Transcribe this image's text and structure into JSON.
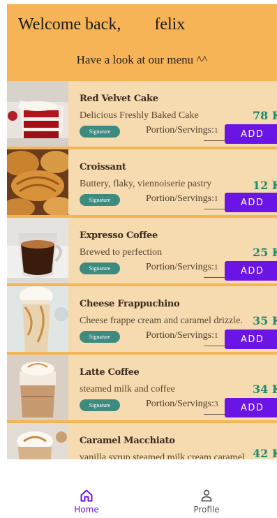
{
  "header": {
    "welcome": "Welcome back,        felix",
    "subtitle": "Have a look at our menu ^^"
  },
  "menu": [
    {
      "name": "Red Velvet Cake",
      "description": "Delicious Freshly Baked Cake",
      "badge": "Signature",
      "portion_label": "Portion/Servings:",
      "portion_value": "1",
      "price": "78 K",
      "add_label": "ADD",
      "image_icon": "red-velvet-cake-image"
    },
    {
      "name": "Croissant",
      "description": "Buttery, flaky, viennoiserie pastry",
      "badge": "Signature",
      "portion_label": "Portion/Servings:",
      "portion_value": "1",
      "price": "12 K",
      "add_label": "ADD",
      "image_icon": "croissant-image"
    },
    {
      "name": "Expresso Coffee",
      "description": "Brewed to perfection",
      "badge": "Signature",
      "portion_label": "Portion/Servings:",
      "portion_value": "1",
      "price": "25 K",
      "add_label": "ADD",
      "image_icon": "espresso-coffee-image"
    },
    {
      "name": "Cheese Frappuchino",
      "description": "Cheese frappe cream and caramel drizzle.",
      "badge": "Signature",
      "portion_label": "Portion/Servings:",
      "portion_value": "1",
      "price": "35 K",
      "add_label": "ADD",
      "image_icon": "frappuccino-image"
    },
    {
      "name": "Latte Coffee",
      "description": "steamed milk and coffee",
      "badge": "Signature",
      "portion_label": "Portion/Servings:",
      "portion_value": "3",
      "price": "34 K",
      "add_label": "ADD",
      "image_icon": "latte-image"
    },
    {
      "name": "Caramel Macchiato",
      "description": "vanilla syrup steamed milk cream caramel",
      "price": "42 K",
      "image_icon": "caramel-macchiato-image"
    }
  ],
  "nav": {
    "home_label": "Home",
    "home_icon": "home-icon",
    "profile_label": "Profile",
    "profile_icon": "profile-icon",
    "active": "Home"
  },
  "colors": {
    "header_bg": "#f6b457",
    "card_bg": "#f6dbb0",
    "badge_bg": "#3d8a7f",
    "price": "#1e8a6e",
    "add_button": "#6a14e6",
    "nav_active": "#6a14e6"
  }
}
